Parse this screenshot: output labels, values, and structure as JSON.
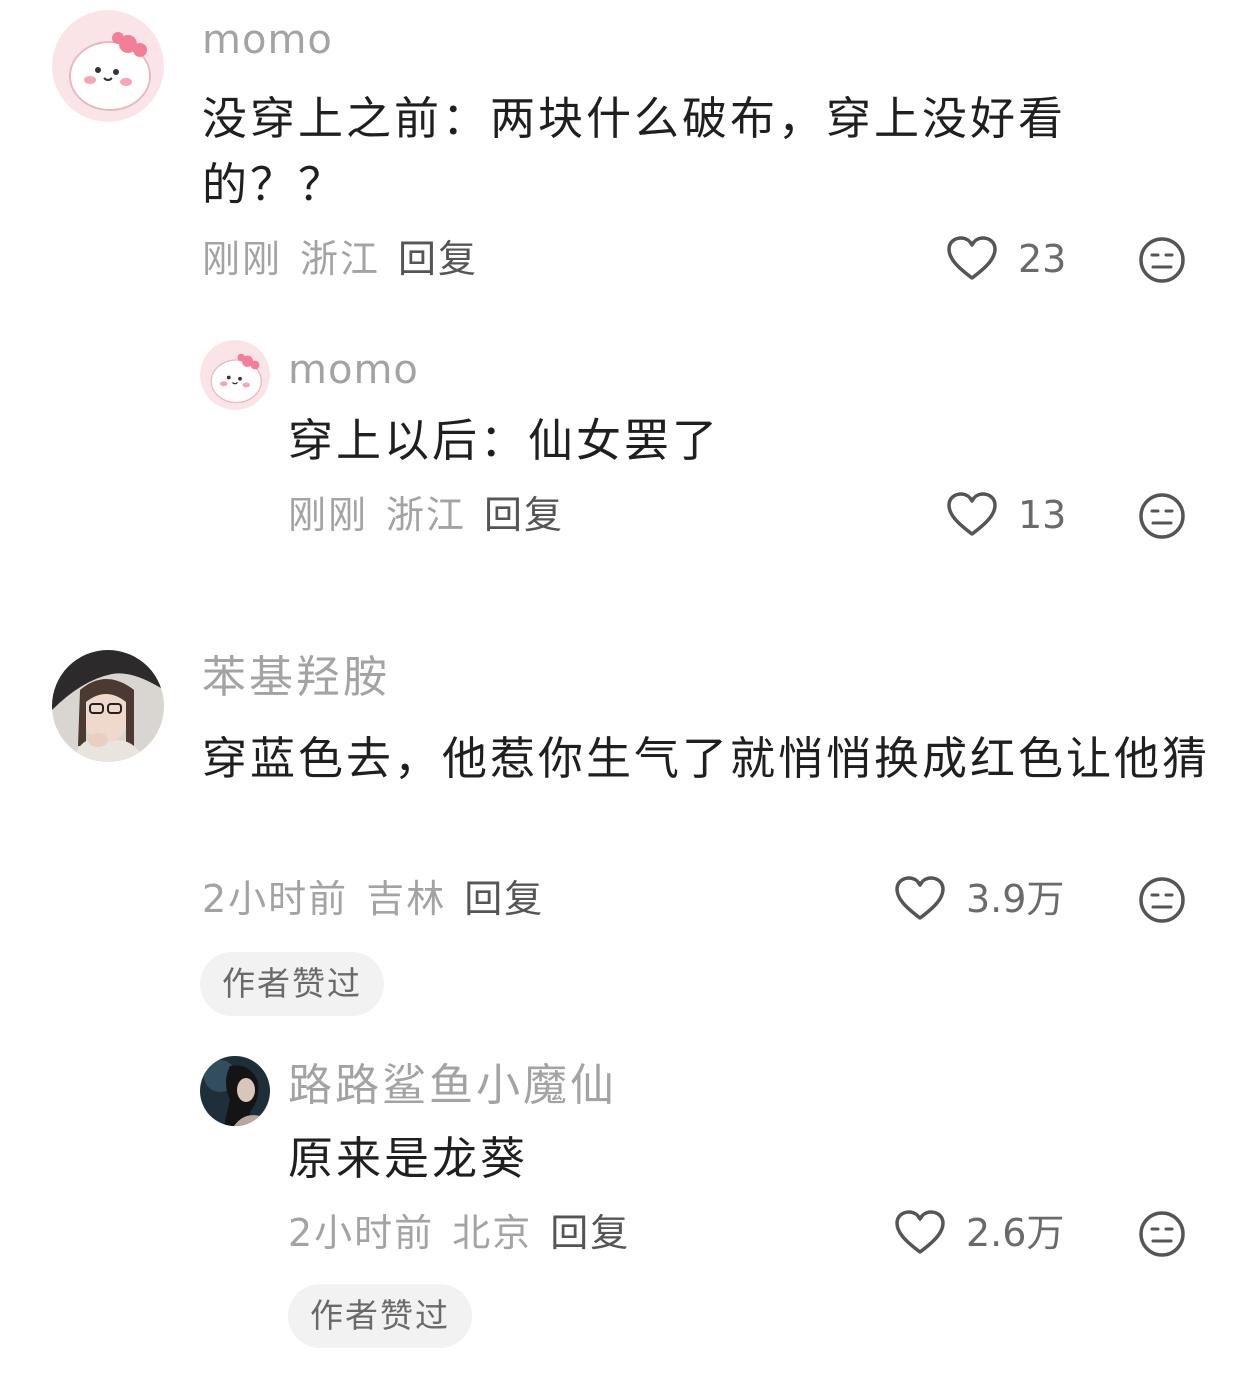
{
  "comments": [
    {
      "user": "momo",
      "text": "没穿上之前：两块什么破布，穿上没好看的？？",
      "time": "刚刚",
      "location": "浙江",
      "reply_label": "回复",
      "likes": "23",
      "avatar_icon": "cartoon-pink-blob-avatar"
    },
    {
      "user": "momo",
      "text": "穿上以后：仙女罢了",
      "time": "刚刚",
      "location": "浙江",
      "reply_label": "回复",
      "likes": "13",
      "avatar_icon": "cartoon-pink-blob-avatar"
    },
    {
      "user": "苯基羟胺",
      "text": "穿蓝色去，他惹你生气了就悄悄换成红色让他猜",
      "time": "2小时前",
      "location": "吉林",
      "reply_label": "回复",
      "likes": "3.9万",
      "badge": "作者赞过",
      "avatar_icon": "photo-avatar-girl-glasses"
    },
    {
      "user": "路路鲨鱼小魔仙",
      "text": "原来是龙葵",
      "time": "2小时前",
      "location": "北京",
      "reply_label": "回复",
      "likes": "2.6万",
      "badge": "作者赞过",
      "avatar_icon": "photo-avatar-dark-portrait"
    }
  ],
  "icons": {
    "like": "heart-outline-icon",
    "dislike": "meh-face-icon"
  },
  "colors": {
    "username": "#a3a3a3",
    "text": "#1f1f1f",
    "badge_bg": "#f2f2f2"
  }
}
